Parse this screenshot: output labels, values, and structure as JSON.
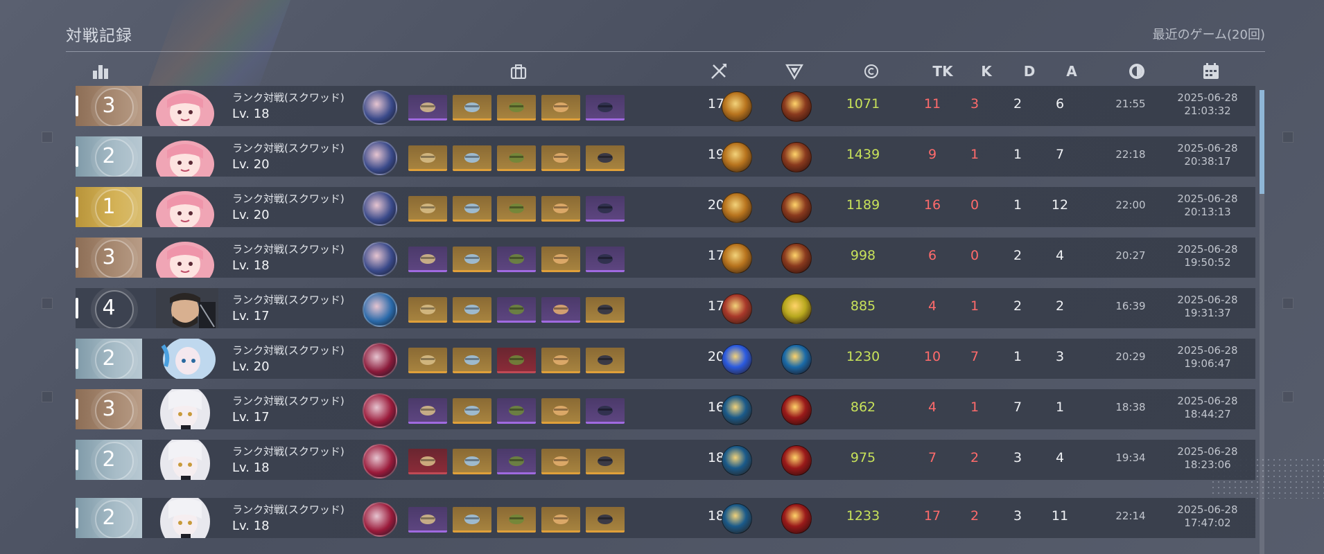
{
  "header": {
    "title": "対戦記録",
    "recent": "最近のゲーム(20回)"
  },
  "columns": {
    "rank_icon": "bar-chart-icon",
    "items_icon": "briefcase-icon",
    "weapon_icon": "crossed-swords-icon",
    "tier_icon": "triangle-emblem-icon",
    "credit_icon": "copyright-coin-icon",
    "tk": "TK",
    "k": "K",
    "d": "D",
    "a": "A",
    "time_icon": "clock-icon",
    "date_icon": "calendar-icon"
  },
  "rows": [
    {
      "rank": "3",
      "rank_style": "bronze",
      "character": "pink-hair",
      "mode": "ランク対戦(スクワッド)",
      "level": "Lv. 18",
      "hero_color": "#3a4a8a",
      "items": [
        "purple",
        "gold",
        "gold",
        "gold",
        "purple"
      ],
      "char_level": "17",
      "skill1": "#b8741e",
      "skill2": "#8a3a1e",
      "score": "1071",
      "tk": "11",
      "k": "3",
      "d": "2",
      "a": "6",
      "duration": "21:55",
      "date": "2025-06-28",
      "time": "21:03:32"
    },
    {
      "rank": "2",
      "rank_style": "silver",
      "character": "pink-hair",
      "mode": "ランク対戦(スクワッド)",
      "level": "Lv. 20",
      "hero_color": "#3a4a8a",
      "items": [
        "gold",
        "gold",
        "gold",
        "gold",
        "gold"
      ],
      "char_level": "19",
      "skill1": "#b8741e",
      "skill2": "#8a3a1e",
      "score": "1439",
      "tk": "9",
      "k": "1",
      "d": "1",
      "a": "7",
      "duration": "22:18",
      "date": "2025-06-28",
      "time": "20:38:17"
    },
    {
      "rank": "1",
      "rank_style": "gold",
      "character": "pink-hair",
      "mode": "ランク対戦(スクワッド)",
      "level": "Lv. 20",
      "hero_color": "#3a4a8a",
      "items": [
        "gold",
        "gold",
        "gold",
        "gold",
        "purple"
      ],
      "char_level": "20",
      "skill1": "#b8741e",
      "skill2": "#8a3a1e",
      "score": "1189",
      "tk": "16",
      "k": "0",
      "d": "1",
      "a": "12",
      "duration": "22:00",
      "date": "2025-06-28",
      "time": "20:13:13"
    },
    {
      "rank": "3",
      "rank_style": "bronze",
      "character": "pink-hair",
      "mode": "ランク対戦(スクワッド)",
      "level": "Lv. 18",
      "hero_color": "#3a4a8a",
      "items": [
        "purple",
        "gold",
        "purple",
        "gold",
        "purple"
      ],
      "char_level": "17",
      "skill1": "#b8741e",
      "skill2": "#8a3a1e",
      "score": "998",
      "tk": "6",
      "k": "0",
      "d": "2",
      "a": "4",
      "duration": "20:27",
      "date": "2025-06-28",
      "time": "19:50:52"
    },
    {
      "rank": "4",
      "rank_style": "plain",
      "character": "bearded-man",
      "mode": "ランク対戦(スクワッド)",
      "level": "Lv. 17",
      "hero_color": "#2a6aaa",
      "items": [
        "gold",
        "gold",
        "purple",
        "purple",
        "gold"
      ],
      "char_level": "17",
      "skill1": "#a8382a",
      "skill2": "#b8a81e",
      "score": "885",
      "tk": "4",
      "k": "1",
      "d": "2",
      "a": "2",
      "duration": "16:39",
      "date": "2025-06-28",
      "time": "19:31:37"
    },
    {
      "rank": "2",
      "rank_style": "silver",
      "character": "blue-hair",
      "mode": "ランク対戦(スクワッド)",
      "level": "Lv. 20",
      "hero_color": "#8a1a3a",
      "items": [
        "gold",
        "gold",
        "red",
        "gold",
        "gold"
      ],
      "char_level": "20",
      "skill1": "#2a5ae0",
      "skill2": "#1a6aa8",
      "score": "1230",
      "tk": "10",
      "k": "7",
      "d": "1",
      "a": "3",
      "duration": "20:29",
      "date": "2025-06-28",
      "time": "19:06:47"
    },
    {
      "rank": "3",
      "rank_style": "bronze",
      "character": "white-hair",
      "mode": "ランク対戦(スクワッド)",
      "level": "Lv. 17",
      "hero_color": "#9a1a3a",
      "items": [
        "purple",
        "gold",
        "purple",
        "gold",
        "purple"
      ],
      "char_level": "16",
      "skill1": "#1a5a8a",
      "skill2": "#9a1a1a",
      "score": "862",
      "tk": "4",
      "k": "1",
      "d": "7",
      "a": "1",
      "duration": "18:38",
      "date": "2025-06-28",
      "time": "18:44:27"
    },
    {
      "rank": "2",
      "rank_style": "silver",
      "character": "white-hair",
      "mode": "ランク対戦(スクワッド)",
      "level": "Lv. 18",
      "hero_color": "#9a1a3a",
      "items": [
        "red",
        "gold",
        "purple",
        "gold",
        "gold"
      ],
      "char_level": "18",
      "skill1": "#1a5a8a",
      "skill2": "#9a1a1a",
      "score": "975",
      "tk": "7",
      "k": "2",
      "d": "3",
      "a": "4",
      "duration": "19:34",
      "date": "2025-06-28",
      "time": "18:23:06"
    },
    {
      "rank": "2",
      "rank_style": "silver",
      "character": "white-hair",
      "mode": "ランク対戦(スクワッド)",
      "level": "Lv. 18",
      "hero_color": "#9a1a3a",
      "items": [
        "purple",
        "gold",
        "gold",
        "gold",
        "gold"
      ],
      "char_level": "18",
      "skill1": "#1a5a8a",
      "skill2": "#9a1a1a",
      "score": "1233",
      "tk": "17",
      "k": "2",
      "d": "3",
      "a": "11",
      "duration": "22:14",
      "date": "2025-06-28",
      "time": "17:47:02"
    }
  ]
}
